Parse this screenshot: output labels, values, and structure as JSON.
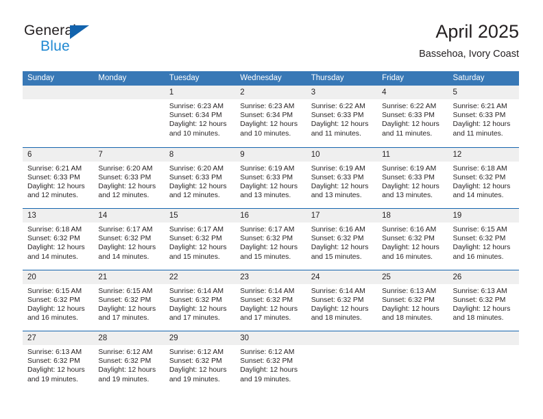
{
  "brand": {
    "name_top": "General",
    "name_bottom": "Blue",
    "triangle_color": "#1263ad",
    "blue_text_color": "#1e88d2"
  },
  "header": {
    "title": "April 2025",
    "location": "Bassehoa, Ivory Coast"
  },
  "theme": {
    "weekday_header_bg": "#3878b6",
    "week_separator": "#1263ad",
    "day_band_bg": "#efefef",
    "text": "#231f20"
  },
  "weekdays": [
    "Sunday",
    "Monday",
    "Tuesday",
    "Wednesday",
    "Thursday",
    "Friday",
    "Saturday"
  ],
  "weeks": [
    [
      {
        "day": "",
        "lines": []
      },
      {
        "day": "",
        "lines": []
      },
      {
        "day": "1",
        "lines": [
          "Sunrise: 6:23 AM",
          "Sunset: 6:34 PM",
          "Daylight: 12 hours",
          "and 10 minutes."
        ]
      },
      {
        "day": "2",
        "lines": [
          "Sunrise: 6:23 AM",
          "Sunset: 6:34 PM",
          "Daylight: 12 hours",
          "and 10 minutes."
        ]
      },
      {
        "day": "3",
        "lines": [
          "Sunrise: 6:22 AM",
          "Sunset: 6:33 PM",
          "Daylight: 12 hours",
          "and 11 minutes."
        ]
      },
      {
        "day": "4",
        "lines": [
          "Sunrise: 6:22 AM",
          "Sunset: 6:33 PM",
          "Daylight: 12 hours",
          "and 11 minutes."
        ]
      },
      {
        "day": "5",
        "lines": [
          "Sunrise: 6:21 AM",
          "Sunset: 6:33 PM",
          "Daylight: 12 hours",
          "and 11 minutes."
        ]
      }
    ],
    [
      {
        "day": "6",
        "lines": [
          "Sunrise: 6:21 AM",
          "Sunset: 6:33 PM",
          "Daylight: 12 hours",
          "and 12 minutes."
        ]
      },
      {
        "day": "7",
        "lines": [
          "Sunrise: 6:20 AM",
          "Sunset: 6:33 PM",
          "Daylight: 12 hours",
          "and 12 minutes."
        ]
      },
      {
        "day": "8",
        "lines": [
          "Sunrise: 6:20 AM",
          "Sunset: 6:33 PM",
          "Daylight: 12 hours",
          "and 12 minutes."
        ]
      },
      {
        "day": "9",
        "lines": [
          "Sunrise: 6:19 AM",
          "Sunset: 6:33 PM",
          "Daylight: 12 hours",
          "and 13 minutes."
        ]
      },
      {
        "day": "10",
        "lines": [
          "Sunrise: 6:19 AM",
          "Sunset: 6:33 PM",
          "Daylight: 12 hours",
          "and 13 minutes."
        ]
      },
      {
        "day": "11",
        "lines": [
          "Sunrise: 6:19 AM",
          "Sunset: 6:33 PM",
          "Daylight: 12 hours",
          "and 13 minutes."
        ]
      },
      {
        "day": "12",
        "lines": [
          "Sunrise: 6:18 AM",
          "Sunset: 6:32 PM",
          "Daylight: 12 hours",
          "and 14 minutes."
        ]
      }
    ],
    [
      {
        "day": "13",
        "lines": [
          "Sunrise: 6:18 AM",
          "Sunset: 6:32 PM",
          "Daylight: 12 hours",
          "and 14 minutes."
        ]
      },
      {
        "day": "14",
        "lines": [
          "Sunrise: 6:17 AM",
          "Sunset: 6:32 PM",
          "Daylight: 12 hours",
          "and 14 minutes."
        ]
      },
      {
        "day": "15",
        "lines": [
          "Sunrise: 6:17 AM",
          "Sunset: 6:32 PM",
          "Daylight: 12 hours",
          "and 15 minutes."
        ]
      },
      {
        "day": "16",
        "lines": [
          "Sunrise: 6:17 AM",
          "Sunset: 6:32 PM",
          "Daylight: 12 hours",
          "and 15 minutes."
        ]
      },
      {
        "day": "17",
        "lines": [
          "Sunrise: 6:16 AM",
          "Sunset: 6:32 PM",
          "Daylight: 12 hours",
          "and 15 minutes."
        ]
      },
      {
        "day": "18",
        "lines": [
          "Sunrise: 6:16 AM",
          "Sunset: 6:32 PM",
          "Daylight: 12 hours",
          "and 16 minutes."
        ]
      },
      {
        "day": "19",
        "lines": [
          "Sunrise: 6:15 AM",
          "Sunset: 6:32 PM",
          "Daylight: 12 hours",
          "and 16 minutes."
        ]
      }
    ],
    [
      {
        "day": "20",
        "lines": [
          "Sunrise: 6:15 AM",
          "Sunset: 6:32 PM",
          "Daylight: 12 hours",
          "and 16 minutes."
        ]
      },
      {
        "day": "21",
        "lines": [
          "Sunrise: 6:15 AM",
          "Sunset: 6:32 PM",
          "Daylight: 12 hours",
          "and 17 minutes."
        ]
      },
      {
        "day": "22",
        "lines": [
          "Sunrise: 6:14 AM",
          "Sunset: 6:32 PM",
          "Daylight: 12 hours",
          "and 17 minutes."
        ]
      },
      {
        "day": "23",
        "lines": [
          "Sunrise: 6:14 AM",
          "Sunset: 6:32 PM",
          "Daylight: 12 hours",
          "and 17 minutes."
        ]
      },
      {
        "day": "24",
        "lines": [
          "Sunrise: 6:14 AM",
          "Sunset: 6:32 PM",
          "Daylight: 12 hours",
          "and 18 minutes."
        ]
      },
      {
        "day": "25",
        "lines": [
          "Sunrise: 6:13 AM",
          "Sunset: 6:32 PM",
          "Daylight: 12 hours",
          "and 18 minutes."
        ]
      },
      {
        "day": "26",
        "lines": [
          "Sunrise: 6:13 AM",
          "Sunset: 6:32 PM",
          "Daylight: 12 hours",
          "and 18 minutes."
        ]
      }
    ],
    [
      {
        "day": "27",
        "lines": [
          "Sunrise: 6:13 AM",
          "Sunset: 6:32 PM",
          "Daylight: 12 hours",
          "and 19 minutes."
        ]
      },
      {
        "day": "28",
        "lines": [
          "Sunrise: 6:12 AM",
          "Sunset: 6:32 PM",
          "Daylight: 12 hours",
          "and 19 minutes."
        ]
      },
      {
        "day": "29",
        "lines": [
          "Sunrise: 6:12 AM",
          "Sunset: 6:32 PM",
          "Daylight: 12 hours",
          "and 19 minutes."
        ]
      },
      {
        "day": "30",
        "lines": [
          "Sunrise: 6:12 AM",
          "Sunset: 6:32 PM",
          "Daylight: 12 hours",
          "and 19 minutes."
        ]
      },
      {
        "day": "",
        "lines": []
      },
      {
        "day": "",
        "lines": []
      },
      {
        "day": "",
        "lines": []
      }
    ]
  ]
}
